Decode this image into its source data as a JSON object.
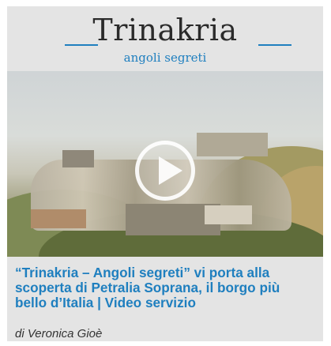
{
  "header": {
    "title": "Trinakria",
    "subtitle": "angoli segreti"
  },
  "media": {
    "play_icon": "play-circle-icon"
  },
  "article": {
    "headline_line1": "“Trinakria – Angoli segreti” vi porta alla",
    "headline_line2": "scoperta di Petralia Soprana, il borgo più",
    "headline_line3": "bello d’Italia | Video servizio",
    "byline": "di Veronica Gioè"
  },
  "colors": {
    "accent": "#1f7fbf",
    "card_bg": "#e4e4e4"
  }
}
